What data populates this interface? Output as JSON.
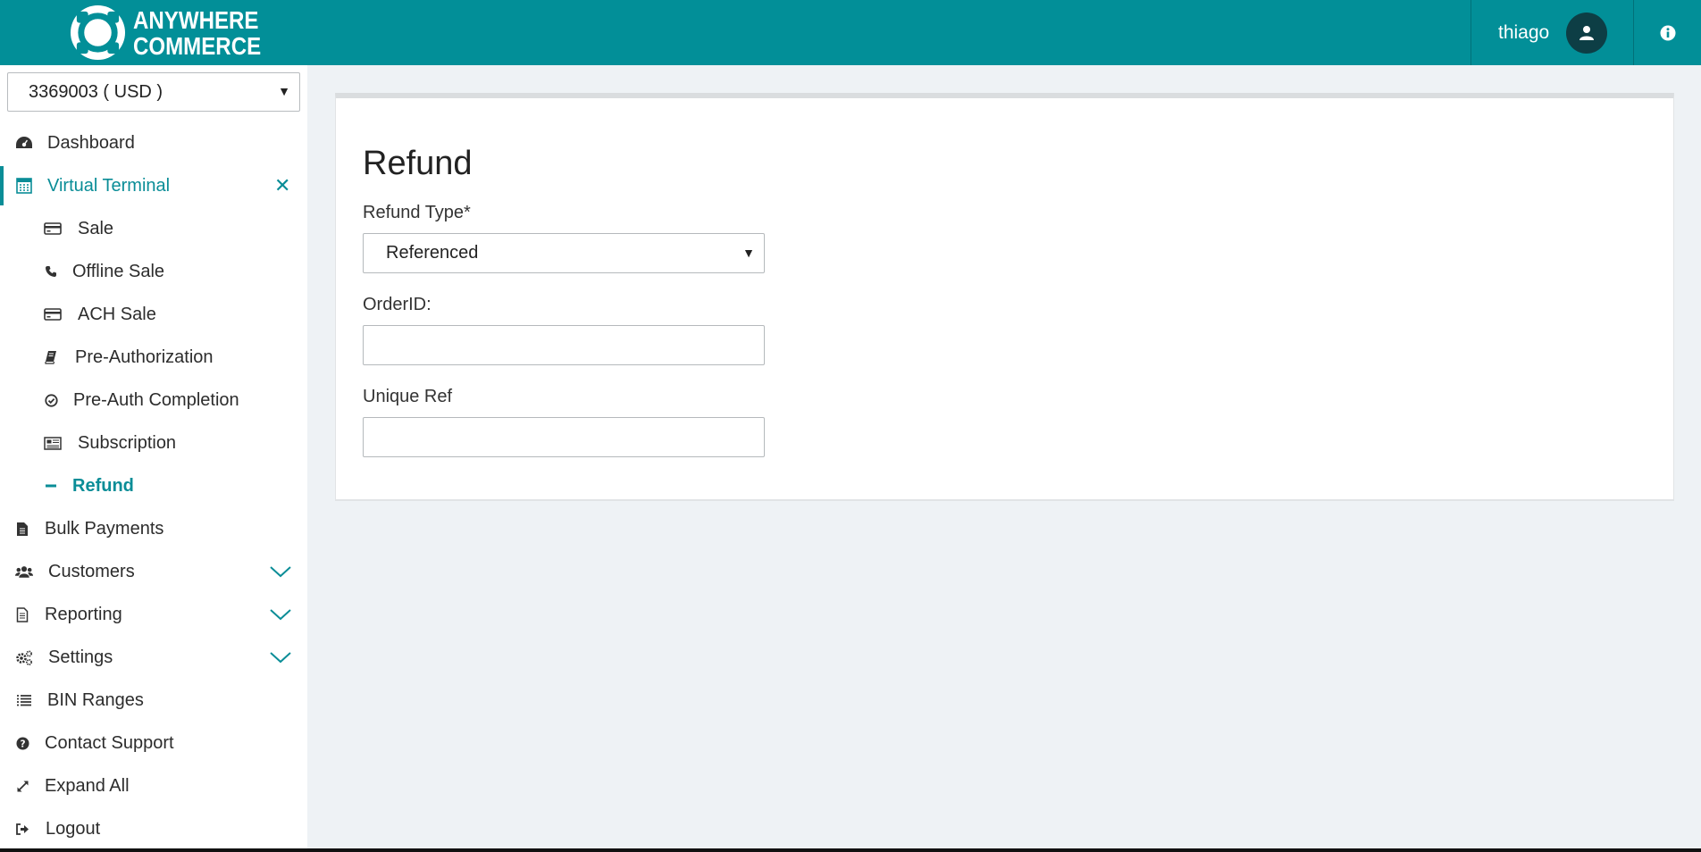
{
  "brand": {
    "line1": "ANYWHERE",
    "line2": "COMMERCE",
    "color": "#028f98"
  },
  "user": {
    "name": "thiago",
    "avatar_icon": "user-icon"
  },
  "header": {
    "info_icon": "info-icon"
  },
  "account": {
    "selected": "3369003 ( USD )"
  },
  "sidebar": {
    "items": [
      {
        "label": "Dashboard",
        "icon": "dashboard-icon"
      },
      {
        "label": "Virtual Terminal",
        "icon": "calculator-icon",
        "active": true
      },
      {
        "label": "Sale",
        "icon": "credit-card-icon"
      },
      {
        "label": "Offline Sale",
        "icon": "phone-icon"
      },
      {
        "label": "ACH Sale",
        "icon": "credit-card-icon"
      },
      {
        "label": "Pre-Authorization",
        "icon": "book-icon"
      },
      {
        "label": "Pre-Auth Completion",
        "icon": "check-circle-icon"
      },
      {
        "label": "Subscription",
        "icon": "newspaper-icon"
      },
      {
        "label": "Refund",
        "icon": "minus-icon",
        "active": true
      },
      {
        "label": "Bulk Payments",
        "icon": "file-icon"
      },
      {
        "label": "Customers",
        "icon": "users-icon"
      },
      {
        "label": "Reporting",
        "icon": "file-text-icon"
      },
      {
        "label": "Settings",
        "icon": "cogs-icon"
      },
      {
        "label": "BIN Ranges",
        "icon": "list-icon"
      },
      {
        "label": "Contact Support",
        "icon": "question-circle-icon"
      },
      {
        "label": "Expand All",
        "icon": "expand-icon"
      },
      {
        "label": "Logout",
        "icon": "sign-out-icon"
      }
    ]
  },
  "main": {
    "title": "Refund",
    "refund_type": {
      "label": "Refund Type*",
      "value": "Referenced"
    },
    "order_id": {
      "label": "OrderID:",
      "value": ""
    },
    "unique_ref": {
      "label": "Unique Ref",
      "value": ""
    }
  },
  "colors": {
    "accent": "#0a8d97",
    "background": "#eef2f5"
  }
}
